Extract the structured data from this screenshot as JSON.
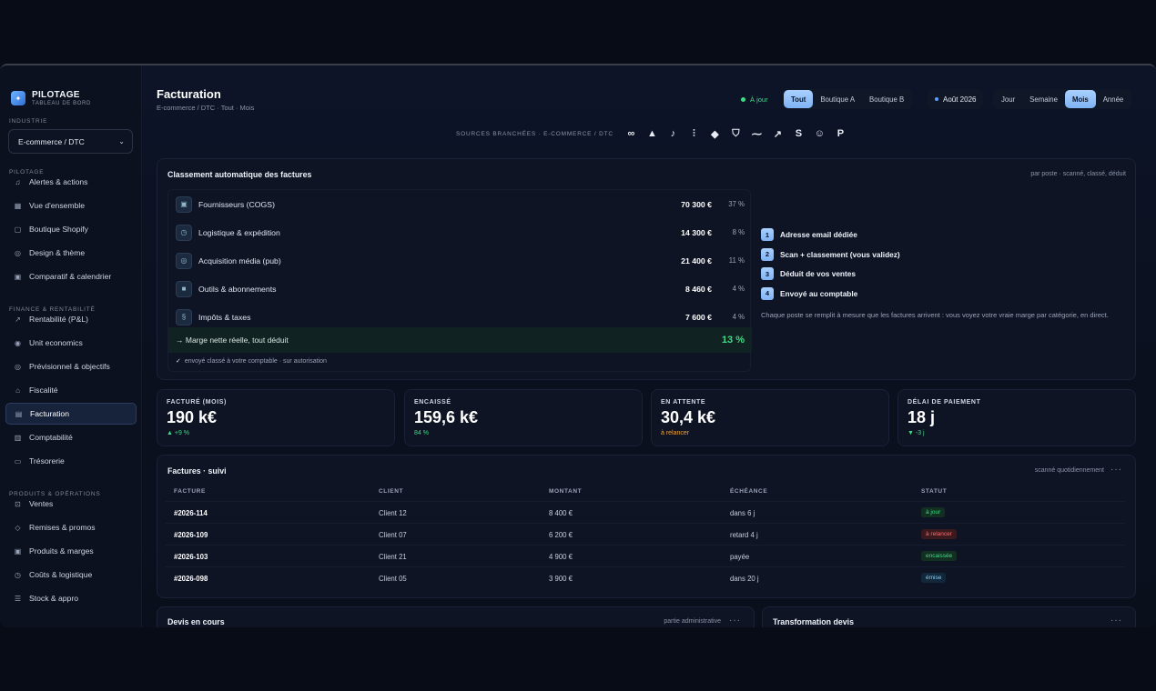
{
  "brand": {
    "title": "PILOTAGE",
    "subtitle": "TABLEAU DE BORD"
  },
  "sidebar": {
    "industry_label": "INDUSTRIE",
    "industry_value": "E-commerce / DTC",
    "section_pilotage": "PILOTAGE",
    "section_finance": "FINANCE & RENTABILITÉ",
    "section_produits": "PRODUITS & OPÉRATIONS",
    "items": [
      {
        "label": "Alertes & actions",
        "icon": "bell-icon"
      },
      {
        "label": "Vue d'ensemble",
        "icon": "grid-icon"
      },
      {
        "label": "Boutique Shopify",
        "icon": "shop-icon"
      },
      {
        "label": "Design & thème",
        "icon": "palette-icon"
      },
      {
        "label": "Comparatif & calendrier",
        "icon": "calendar-icon"
      },
      {
        "label": "Rentabilité (P&L)",
        "icon": "trend-icon"
      },
      {
        "label": "Unit economics",
        "icon": "coin-icon"
      },
      {
        "label": "Prévisionnel & objectifs",
        "icon": "target-icon"
      },
      {
        "label": "Fiscalité",
        "icon": "bank-icon"
      },
      {
        "label": "Facturation",
        "icon": "invoice-icon"
      },
      {
        "label": "Comptabilité",
        "icon": "ledger-icon"
      },
      {
        "label": "Trésorerie",
        "icon": "wallet-icon"
      },
      {
        "label": "Ventes",
        "icon": "cart-icon"
      },
      {
        "label": "Remises & promos",
        "icon": "tag-icon"
      },
      {
        "label": "Produits & marges",
        "icon": "box-icon"
      },
      {
        "label": "Coûts & logistique",
        "icon": "truck-icon"
      },
      {
        "label": "Stock & appro",
        "icon": "stack-icon"
      }
    ]
  },
  "header": {
    "title": "Facturation",
    "breadcrumb": "E-commerce / DTC · Tout · Mois",
    "status": "À jour",
    "shops": [
      "Tout",
      "Boutique A",
      "Boutique B"
    ],
    "period": "Août 2026",
    "granularity": [
      "Jour",
      "Semaine",
      "Mois",
      "Année"
    ]
  },
  "sources": {
    "label": "SOURCES BRANCHÉES · E-COMMERCE / DTC",
    "icons": [
      "meta-icon",
      "google-ads-icon",
      "tiktok-icon",
      "analytics-icon",
      "klaviyo-icon",
      "shopify-icon",
      "dash-icon",
      "stripe-arrow-icon",
      "stripe-icon",
      "mailchimp-icon",
      "paypal-icon"
    ]
  },
  "classement": {
    "title": "Classement automatique des factures",
    "note": "par poste · scanné, classé, déduit",
    "rows": [
      {
        "icon": "box-icon",
        "label": "Fournisseurs (COGS)",
        "amount": "70 300 €",
        "pct": "37 %"
      },
      {
        "icon": "truck-icon",
        "label": "Logistique & expédition",
        "amount": "14 300 €",
        "pct": "8 %"
      },
      {
        "icon": "target-icon",
        "label": "Acquisition média (pub)",
        "amount": "21 400 €",
        "pct": "11 %"
      },
      {
        "icon": "tool-icon",
        "label": "Outils & abonnements",
        "amount": "8 460 €",
        "pct": "4 %"
      },
      {
        "icon": "section-icon",
        "label": "Impôts & taxes",
        "amount": "7 600 €",
        "pct": "4 %"
      }
    ],
    "margin_label": "→ Marge nette réelle, tout déduit",
    "margin_value": "13 %",
    "sent_note": "envoyé classé à votre comptable · sur autorisation",
    "steps": [
      {
        "num": "1",
        "label": "Adresse email dédiée"
      },
      {
        "num": "2",
        "label": "Scan + classement (vous validez)"
      },
      {
        "num": "3",
        "label": "Déduit de vos ventes"
      },
      {
        "num": "4",
        "label": "Envoyé au comptable"
      }
    ],
    "steps_note": "Chaque poste se remplit à mesure que les factures arrivent : vous voyez votre vraie marge par catégorie, en direct."
  },
  "kpis": [
    {
      "label": "FACTURÉ (MOIS)",
      "value": "190 k€",
      "sub": "▲ +9 %",
      "sub_color": "#3ddc84"
    },
    {
      "label": "ENCAISSÉ",
      "value": "159,6 k€",
      "sub": "84 %",
      "sub_color": "#3ddc84"
    },
    {
      "label": "EN ATTENTE",
      "value": "30,4 k€",
      "sub": "à relancer",
      "sub_color": "#f0a53a"
    },
    {
      "label": "DÉLAI DE PAIEMENT",
      "value": "18 j",
      "sub": "▼ -3 j",
      "sub_color": "#3ddc84"
    }
  ],
  "factures": {
    "title": "Factures · suivi",
    "note": "scanné quotidiennement",
    "columns": [
      "FACTURE",
      "CLIENT",
      "MONTANT",
      "ÉCHÉANCE",
      "STATUT"
    ],
    "rows": [
      {
        "facture": "#2026-114",
        "client": "Client 12",
        "montant": "8 400 €",
        "echeance": "dans 6 j",
        "statut": "à jour",
        "color": "#3ddc84",
        "bg": "#123022"
      },
      {
        "facture": "#2026-109",
        "client": "Client 07",
        "montant": "6 200 €",
        "echeance": "retard 4 j",
        "statut": "à relancer",
        "color": "#ff6b6b",
        "bg": "#3a1a1f"
      },
      {
        "facture": "#2026-103",
        "client": "Client 21",
        "montant": "4 900 €",
        "echeance": "payée",
        "statut": "encaissée",
        "color": "#3ddc84",
        "bg": "#123022"
      },
      {
        "facture": "#2026-098",
        "client": "Client 05",
        "montant": "3 900 €",
        "echeance": "dans 20 j",
        "statut": "émise",
        "color": "#7fd0ff",
        "bg": "#12283a"
      }
    ]
  },
  "devis": {
    "title": "Devis en cours",
    "note": "partie administrative"
  },
  "transformation": {
    "title": "Transformation devis"
  },
  "more_label": "···"
}
